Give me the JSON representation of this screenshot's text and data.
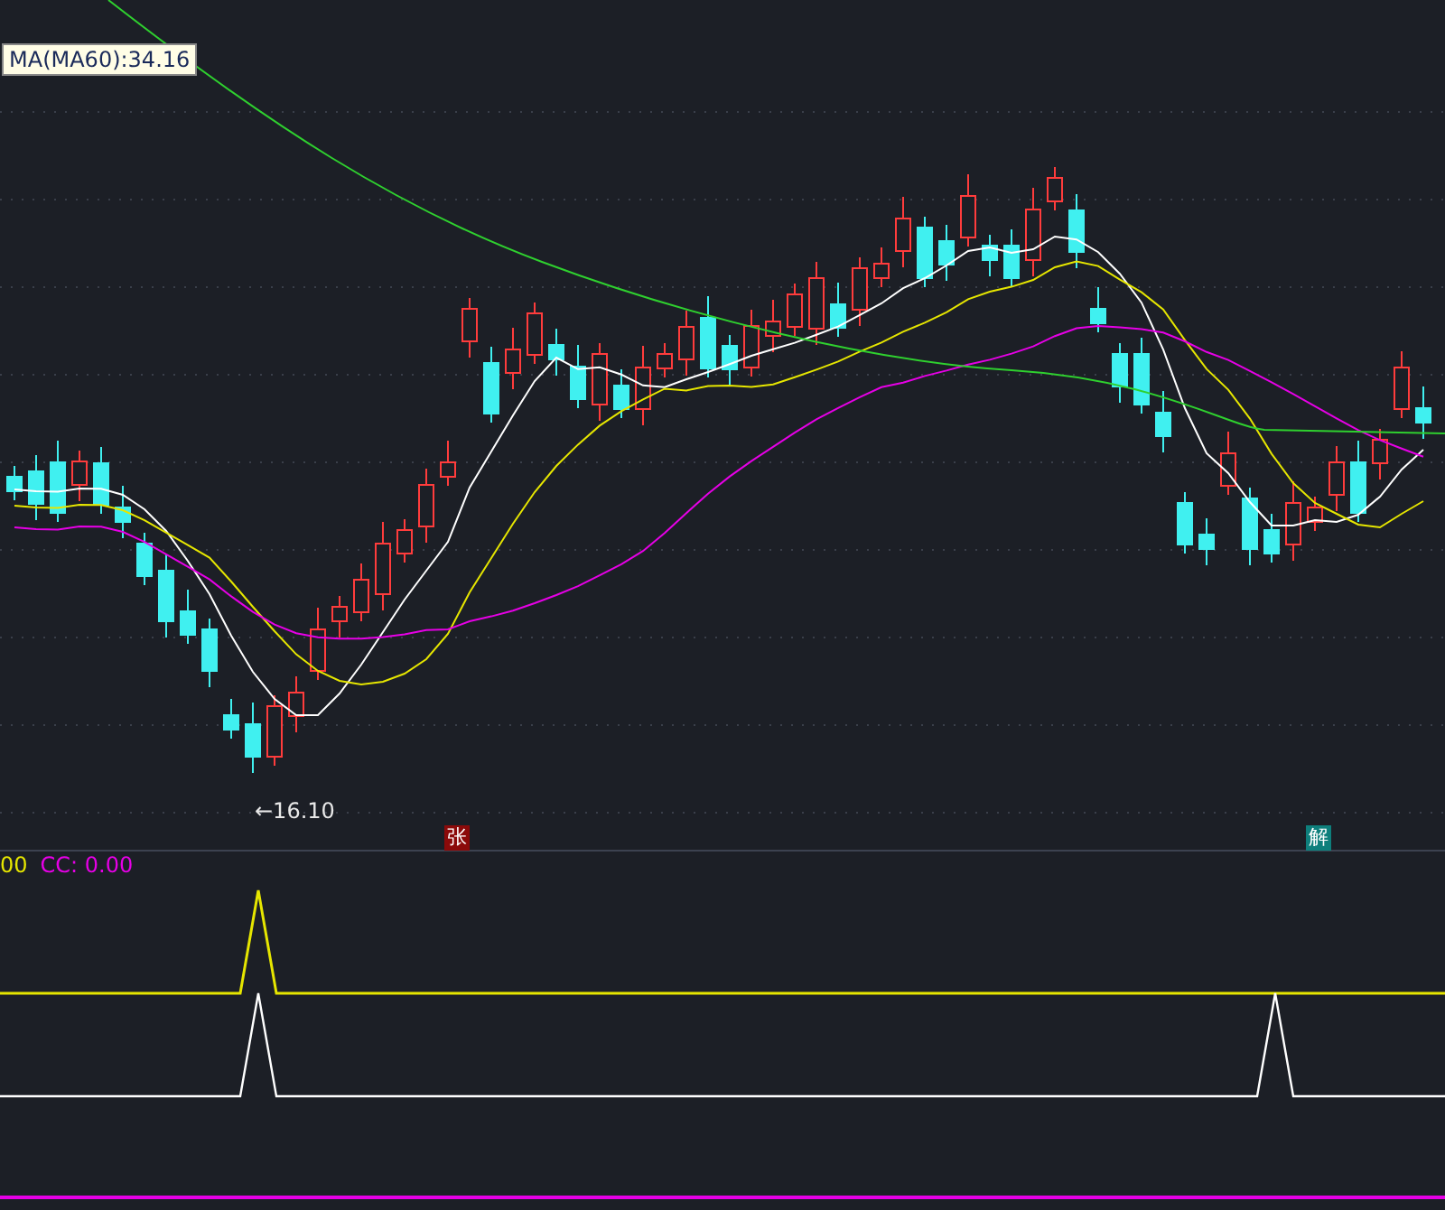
{
  "tooltip": {
    "text": "MA(MA60):34.16"
  },
  "low_marker": {
    "text": "←16.10"
  },
  "badges": [
    {
      "text": "张",
      "color": "#8b0a0a"
    },
    {
      "text": "解",
      "color": "#0e7f7c"
    }
  ],
  "indicator_legend": [
    {
      "text": "00",
      "color": "#e6e600"
    },
    {
      "text": "CC: 0.00",
      "color": "#e600e6"
    }
  ]
}
